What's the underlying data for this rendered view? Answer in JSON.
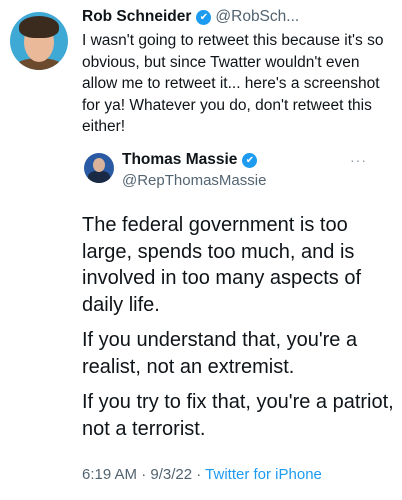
{
  "outer_tweet": {
    "author_name": "Rob Schneider",
    "verified_mark": "✔",
    "handle": "@RobSch...",
    "text": "I wasn't going to retweet this because it's so obvious, but since Twatter wouldn't even allow me to retweet it... here's a screenshot for ya! Whatever you do, don't retweet this either!"
  },
  "quoted_tweet": {
    "author_name": "Thomas Massie",
    "verified_mark": "✔",
    "handle": "@RepThomasMassie",
    "more_glyph": "···",
    "paragraphs": [
      "The federal government is too large, spends too much, and is involved in too many aspects of daily life.",
      "If you understand that, you're a realist, not an extremist.",
      "If you try to fix that, you're a patriot, not a terrorist."
    ],
    "time": "6:19 AM",
    "sep1": " · ",
    "date": "9/3/22",
    "sep2": " · ",
    "source": "Twitter for iPhone"
  },
  "colors": {
    "accent": "#1d9bf0",
    "text": "#0f1419",
    "muted": "#536471"
  }
}
